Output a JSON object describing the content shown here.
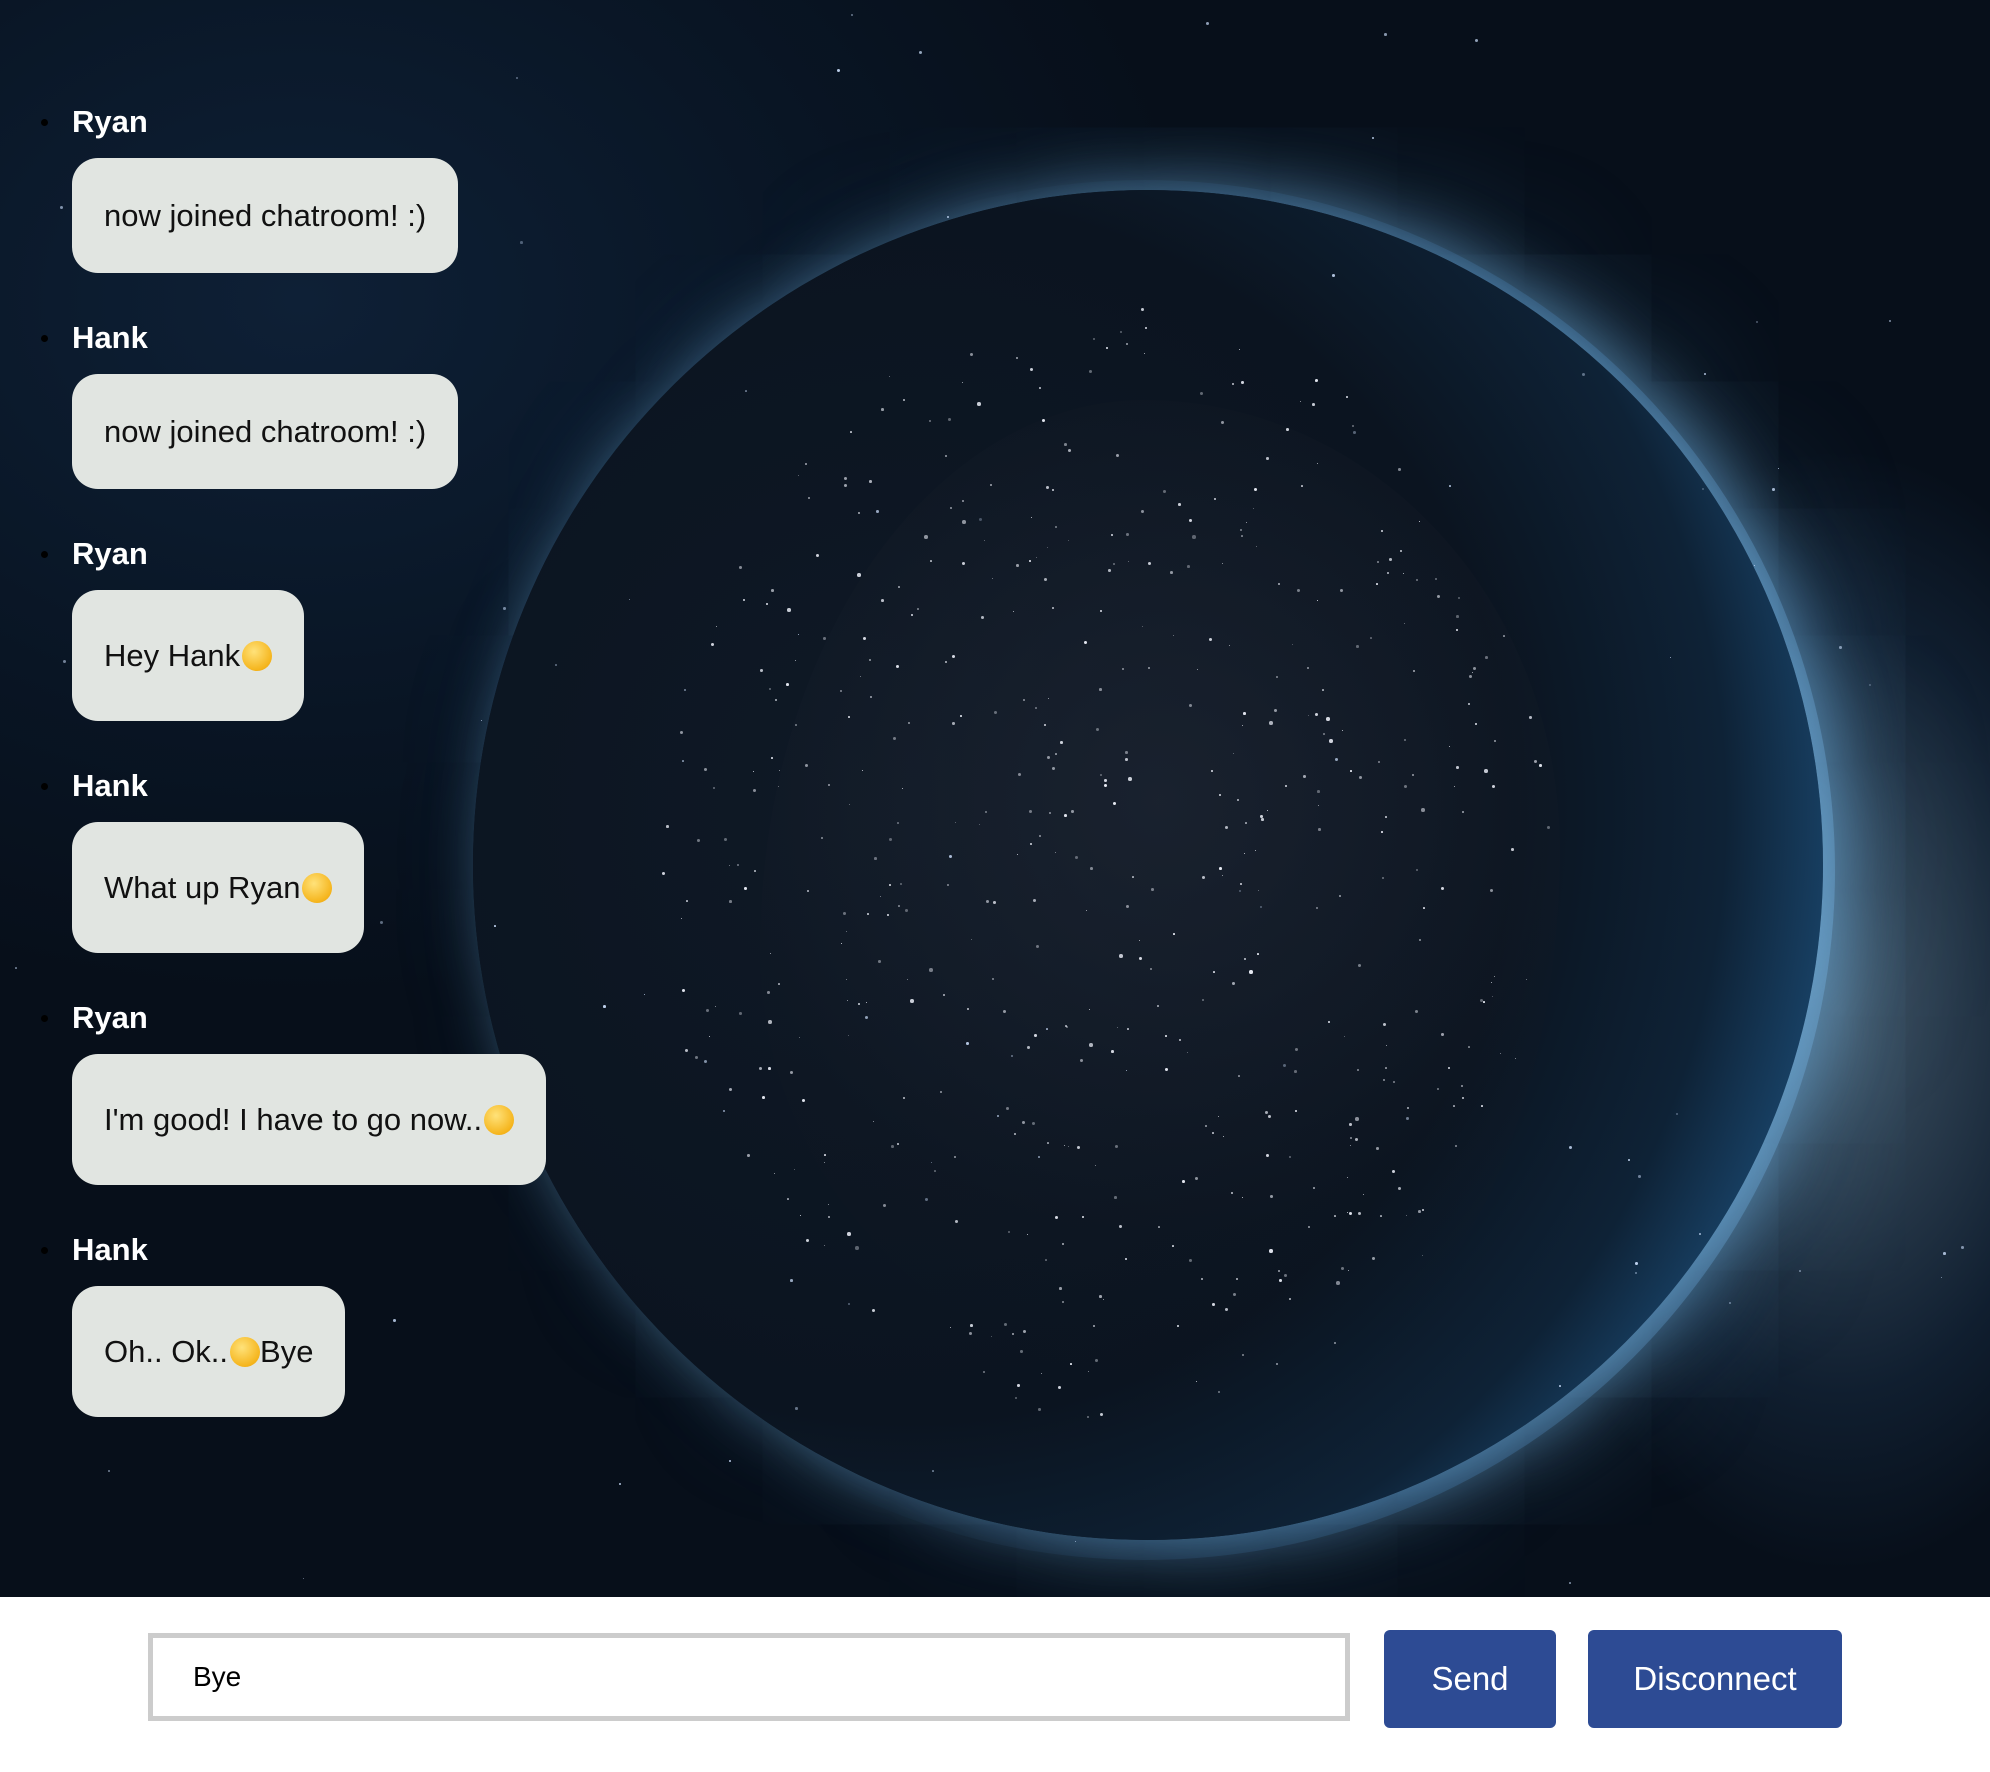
{
  "chat": {
    "messages": [
      {
        "user": "Ryan",
        "text": "now joined chatroom! :)",
        "emoji": null
      },
      {
        "user": "Hank",
        "text": "now joined chatroom! :)",
        "emoji": null
      },
      {
        "user": "Ryan",
        "text": "Hey Hank",
        "emoji": "squinting-face-with-tongue-emoji"
      },
      {
        "user": "Hank",
        "text": "What up Ryan",
        "emoji": "smiling-face-with-halo-emoji"
      },
      {
        "user": "Ryan",
        "text": "I'm good! I have to go now..",
        "emoji": "face-screaming-in-fear-emoji"
      },
      {
        "user": "Hank",
        "text": "Oh.. Ok..",
        "emoji": "persevering-face-emoji",
        "text_after": "Bye"
      }
    ]
  },
  "composer": {
    "input_value": "Bye",
    "send_label": "Send",
    "disconnect_label": "Disconnect"
  },
  "colors": {
    "bubble": "#e1e5e1",
    "button": "#2d4b94",
    "username": "#ffffff",
    "background": "#091524"
  }
}
